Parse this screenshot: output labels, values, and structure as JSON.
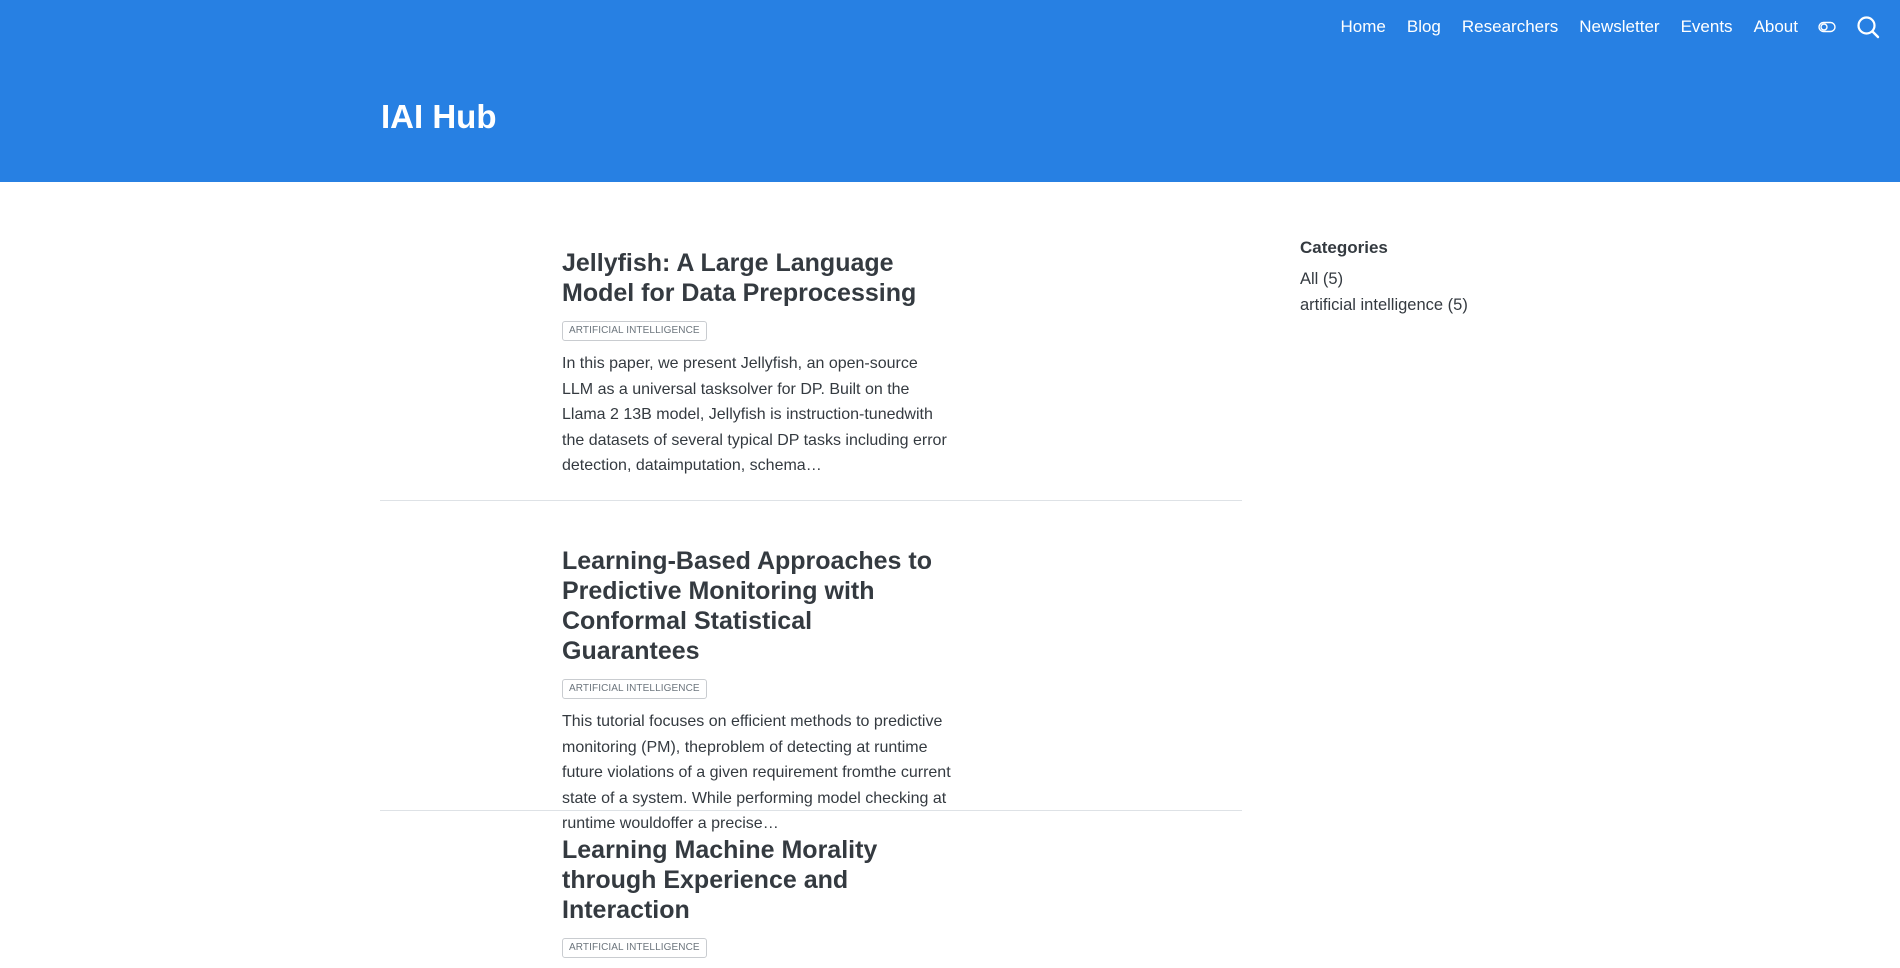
{
  "nav": {
    "links": [
      "Home",
      "Blog",
      "Researchers",
      "Newsletter",
      "Events",
      "About"
    ],
    "toggle_icon": "toggle-icon",
    "search_icon": "search-icon"
  },
  "site": {
    "title": "IAI Hub"
  },
  "posts": [
    {
      "title": "Jellyfish: A Large Language Model for Data Preprocessing",
      "category": "ARTIFICIAL INTELLIGENCE",
      "description": "In this paper, we present Jellyfish, an open-source LLM as a universal tasksolver for DP. Built on the Llama 2 13B model, Jellyfish is instruction-tunedwith the datasets of several typical DP tasks including error detection, dataimputation, schema…"
    },
    {
      "title": "Learning-Based Approaches to Predictive Monitoring with Conformal Statistical Guarantees",
      "category": "ARTIFICIAL INTELLIGENCE",
      "description": "This tutorial focuses on efficient methods to predictive monitoring (PM), theproblem of detecting at runtime future violations of a given requirement fromthe current state of a system. While performing model checking at runtime wouldoffer a precise…"
    },
    {
      "title": "Learning Machine Morality through Experience and Interaction",
      "category": "ARTIFICIAL INTELLIGENCE",
      "description": ""
    }
  ],
  "sidebar": {
    "title": "Categories",
    "items": [
      "All (5)",
      "artificial intelligence (5)"
    ]
  },
  "colors": {
    "navbar": "#2780e3",
    "text": "#343a40",
    "badge_border": "#c9ccd0"
  }
}
